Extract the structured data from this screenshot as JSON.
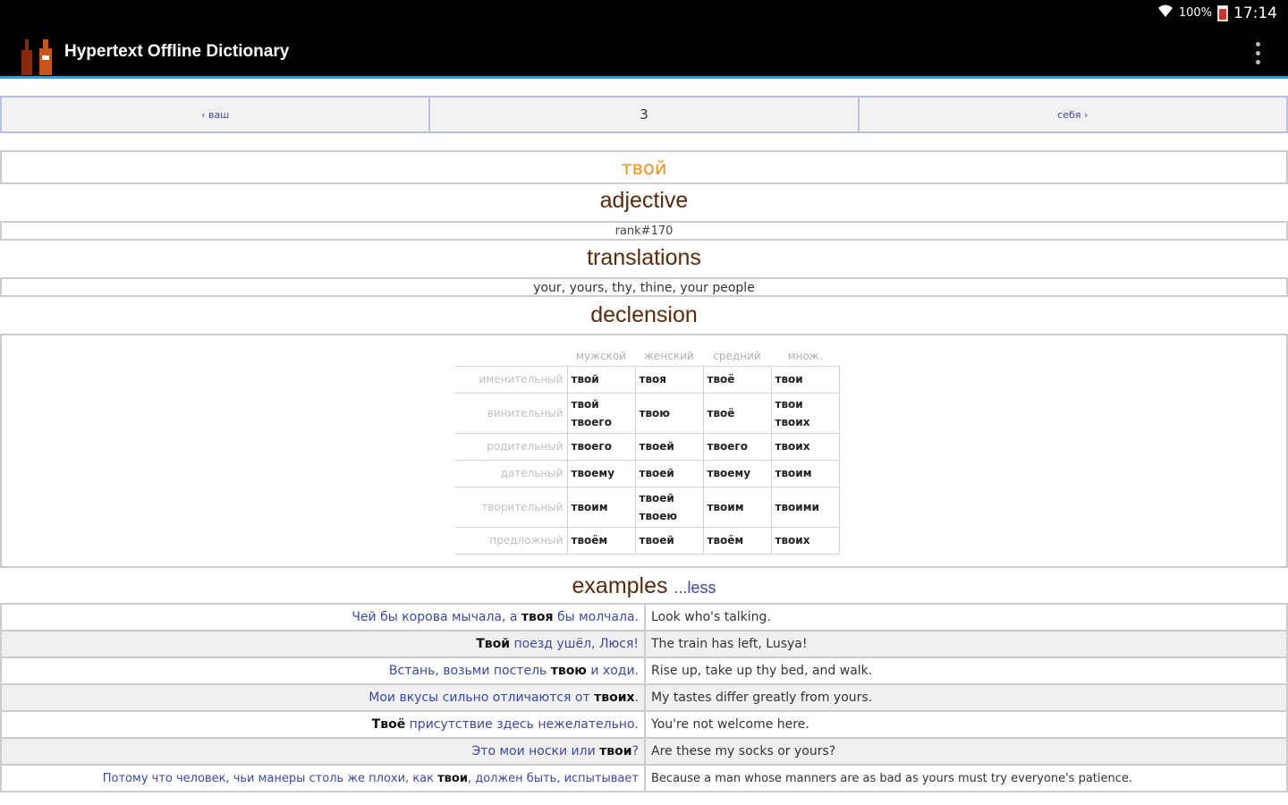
{
  "status": {
    "battery": "100%",
    "time": "17:14"
  },
  "app": {
    "title": "Hypertext Offline Dictionary"
  },
  "nav": {
    "prev": "‹ ваш",
    "page": "3",
    "next": "себя ›"
  },
  "entry": {
    "word": "твой",
    "pos": "adjective",
    "rank": "rank#170",
    "translations_heading": "translations",
    "translations": "your, yours, thy, thine, your people",
    "declension_heading": "declension"
  },
  "declension": {
    "headers": [
      "мужской",
      "женский",
      "средний",
      "множ."
    ],
    "rows": [
      {
        "case": "именительный",
        "forms": [
          "твой",
          "твоя",
          "твоё",
          "твои"
        ]
      },
      {
        "case": "винительный",
        "forms": [
          "твой\nтвоего",
          "твою",
          "твоё",
          "твои\nтвоих"
        ]
      },
      {
        "case": "родительный",
        "forms": [
          "твоего",
          "твоей",
          "твоего",
          "твоих"
        ]
      },
      {
        "case": "дательный",
        "forms": [
          "твоему",
          "твоей",
          "твоему",
          "твоим"
        ]
      },
      {
        "case": "творительный",
        "forms": [
          "твоим",
          "твоей\nтвоею",
          "твоим",
          "твоими"
        ]
      },
      {
        "case": "предложный",
        "forms": [
          "твоём",
          "твоей",
          "твоём",
          "твоих"
        ]
      }
    ]
  },
  "examples": {
    "heading": "examples",
    "less_link": "...less",
    "rows": [
      {
        "ru_pre": "Чей бы корова мычала, а ",
        "ru_bold": "твоя",
        "ru_post": " бы молчала.",
        "en": "Look who's talking."
      },
      {
        "ru_pre": "",
        "ru_bold": "Твой",
        "ru_post": " поезд ушёл, Люся!",
        "en": "The train has left, Lusya!"
      },
      {
        "ru_pre": "Встань, возьми постель ",
        "ru_bold": "твою",
        "ru_post": " и ходи.",
        "en": "Rise up, take up thy bed, and walk."
      },
      {
        "ru_pre": "Мои вкусы сильно отличаются от ",
        "ru_bold": "твоих",
        "ru_post": ".",
        "en": "My tastes differ greatly from yours."
      },
      {
        "ru_pre": "",
        "ru_bold": "Твоё",
        "ru_post": " присутствие здесь нежелательно.",
        "en": "You're not welcome here."
      },
      {
        "ru_pre": "Это мои носки или ",
        "ru_bold": "твои",
        "ru_post": "?",
        "en": "Are these my socks or yours?"
      },
      {
        "ru_pre": "Потому что человек, чьи манеры столь же плохи, как ",
        "ru_bold": "твои",
        "ru_post": ", должен быть, испытывает",
        "en": "Because a man whose manners are as bad as yours must try everyone's patience."
      }
    ]
  }
}
